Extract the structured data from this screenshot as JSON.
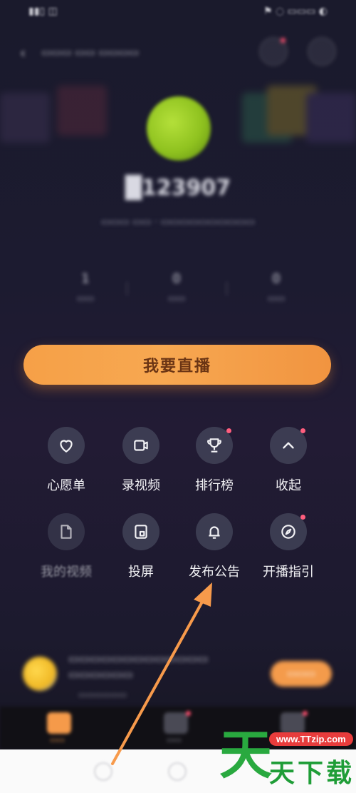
{
  "status_bar": {
    "left": "▮▮▯ ◫",
    "right": "⚑ ◌ ▭▭▭ ◐"
  },
  "top_bar": {
    "title": "▭▭▭ ▭▭ ▭▭▭▭"
  },
  "profile": {
    "username": "█123907",
    "info": "▭▭▭ ▭▭ · ▭▭▭▭▭▭▭▭▭▭"
  },
  "stats": [
    {
      "value": "1",
      "label": "▭▭"
    },
    {
      "value": "0",
      "label": "▭▭"
    },
    {
      "value": "0",
      "label": "▭▭"
    }
  ],
  "live_button": {
    "label": "我要直播"
  },
  "menu": [
    {
      "label": "心愿单",
      "icon": "heart-icon",
      "badge": false,
      "faded": false
    },
    {
      "label": "录视频",
      "icon": "video-camera-icon",
      "badge": false,
      "faded": false
    },
    {
      "label": "排行榜",
      "icon": "trophy-icon",
      "badge": true,
      "faded": false
    },
    {
      "label": "收起",
      "icon": "chevron-up-icon",
      "badge": true,
      "faded": false
    },
    {
      "label": "我的视频",
      "icon": "document-icon",
      "badge": false,
      "faded": true
    },
    {
      "label": "投屏",
      "icon": "cast-screen-icon",
      "badge": false,
      "faded": false
    },
    {
      "label": "发布公告",
      "icon": "bell-icon",
      "badge": false,
      "faded": false
    },
    {
      "label": "开播指引",
      "icon": "compass-icon",
      "badge": true,
      "faded": false
    }
  ],
  "promo": {
    "text": "▭▭▭▭▭▭▭▭▭▭▭▭▭ ▭▭▭▭▭▭",
    "sub": "▭▭▭▭▭▭",
    "button": "▭▭▭"
  },
  "tabs": [
    {
      "label": "▭▭",
      "active": true
    },
    {
      "label": "▭▭",
      "active": false
    },
    {
      "label": "▭▭",
      "active": false
    }
  ],
  "watermark": {
    "url": "www.TTzip.com",
    "first_char": "天",
    "rest": "天下载"
  },
  "colors": {
    "accent_orange": "#f6a047",
    "badge_pink": "#ff5e7e",
    "watermark_green": "#29a93f",
    "arrow_orange": "#f79a4b"
  }
}
